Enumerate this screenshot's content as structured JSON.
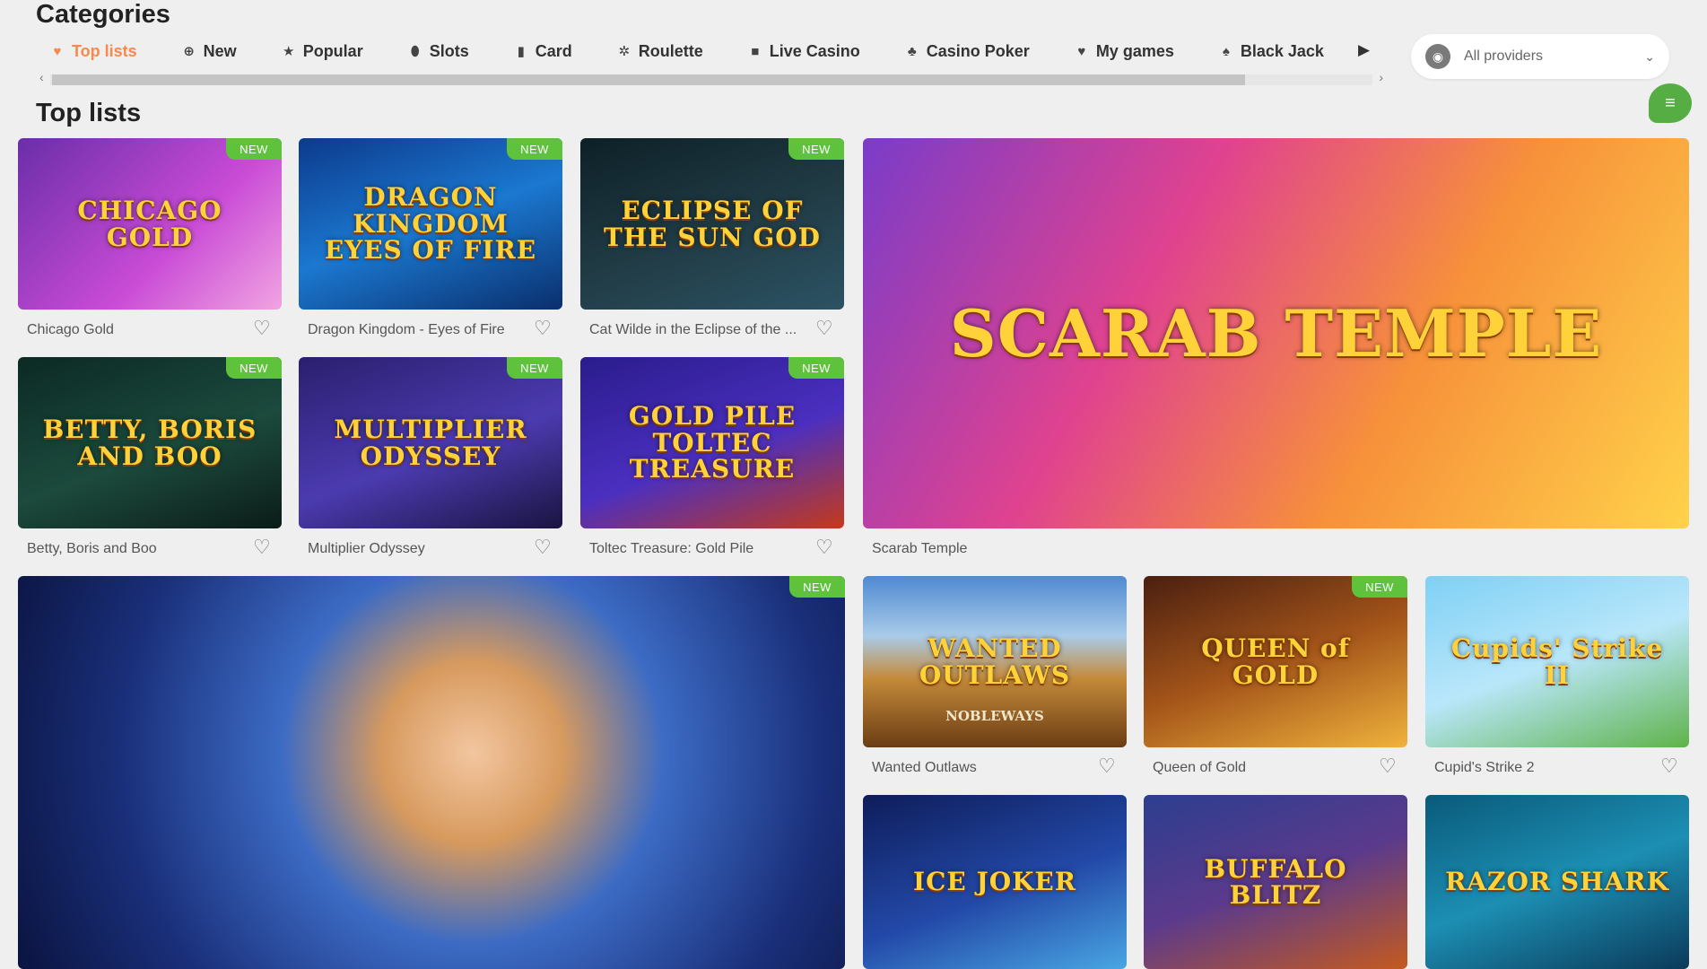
{
  "categories_heading": "Categories",
  "categories": [
    {
      "label": "Top lists",
      "icon": "heart-icon",
      "glyph": "♥",
      "active": true
    },
    {
      "label": "New",
      "icon": "plus-circle-icon",
      "glyph": "⊕",
      "active": false
    },
    {
      "label": "Popular",
      "icon": "star-icon",
      "glyph": "★",
      "active": false
    },
    {
      "label": "Slots",
      "icon": "slots-icon",
      "glyph": "⬮",
      "active": false
    },
    {
      "label": "Card",
      "icon": "card-icon",
      "glyph": "▮",
      "active": false
    },
    {
      "label": "Roulette",
      "icon": "roulette-icon",
      "glyph": "✲",
      "active": false
    },
    {
      "label": "Live Casino",
      "icon": "camera-icon",
      "glyph": "■",
      "active": false
    },
    {
      "label": "Casino Poker",
      "icon": "club-icon",
      "glyph": "♣",
      "active": false
    },
    {
      "label": "My games",
      "icon": "heart-icon",
      "glyph": "♥",
      "active": false
    },
    {
      "label": "Black Jack",
      "icon": "spade-icon",
      "glyph": "♠",
      "active": false
    }
  ],
  "category_next_glyph": "▶",
  "providers": {
    "label": "All providers",
    "icon_glyph": "◉",
    "chevron": "⌄"
  },
  "chat_glyph": "≡",
  "section_heading": "Top lists",
  "badge_text": "NEW",
  "heart_glyph": "♡",
  "games": [
    {
      "name": "Chicago Gold",
      "logo": "CHICAGO GOLD",
      "is_new": true,
      "bg": "linear-gradient(135deg,#6a2ea8,#c94bd6 60%,#f1a4e2)"
    },
    {
      "name": "Dragon Kingdom - Eyes of Fire",
      "logo": "DRAGON KINGDOM EYES OF FIRE",
      "is_new": true,
      "bg": "linear-gradient(160deg,#0c3a8c,#1b78d0 50%,#0a2f6d)"
    },
    {
      "name": "Cat Wilde in the Eclipse of the ...",
      "logo": "ECLIPSE OF THE SUN GOD",
      "is_new": true,
      "bg": "linear-gradient(160deg,#0d2027,#203a43 50%,#2c5364)"
    },
    {
      "name": "Scarab Temple",
      "logo": "SCARAB TEMPLE",
      "is_new": false,
      "bg": "linear-gradient(120deg,#7a3cc9,#e0428f 35%,#f7913a 65%,#ffd24a)"
    },
    {
      "name": "Betty, Boris and Boo",
      "logo": "BETTY, BORIS AND BOO",
      "is_new": true,
      "bg": "linear-gradient(160deg,#0b2a24,#1c4a3d 55%,#0b1c18)"
    },
    {
      "name": "Multiplier Odyssey",
      "logo": "MULTIPLIER ODYSSEY",
      "is_new": true,
      "bg": "linear-gradient(160deg,#2a1f6e,#4b3bb0 55%,#1a1440)"
    },
    {
      "name": "Toltec Treasure: Gold Pile",
      "logo": "GOLD PILE TOLTEC TREASURE",
      "is_new": true,
      "bg": "linear-gradient(160deg,#2a1c8c,#4b2fc0 55%,#c43a1a)"
    },
    {
      "name": "",
      "logo": "",
      "is_new": true,
      "bg": "radial-gradient(circle at 55% 45%,#f3c6a0 0%,#d79a5e 18%,#3c6bc4 38%,#1a2f7a 70%,#0b1440 100%)"
    },
    {
      "name": "Wanted Outlaws",
      "logo": "WANTED OUTLAWS",
      "sub": "NOBLEWAYS",
      "is_new": false,
      "bg": "linear-gradient(180deg,#4e8ad1,#a9cbe8 35%,#c48a3a 60%,#6b3c14)"
    },
    {
      "name": "Queen of Gold",
      "logo": "QUEEN of GOLD",
      "is_new": true,
      "bg": "linear-gradient(160deg,#4a1f10,#a35419 50%,#f0b23c)"
    },
    {
      "name": "Cupid's Strike 2",
      "logo": "Cupids' Strike II",
      "is_new": false,
      "bg": "linear-gradient(160deg,#7fd0f5,#b9e7fa 50%,#5fb34a)"
    },
    {
      "name": "",
      "logo": "ICE JOKER",
      "is_new": false,
      "bg": "linear-gradient(160deg,#0e1d5a,#2349a8 55%,#49a6e3)"
    },
    {
      "name": "",
      "logo": "BUFFALO BLITZ",
      "is_new": false,
      "bg": "linear-gradient(160deg,#2c3e8f,#5b3a8c 50%,#c45a1f)"
    },
    {
      "name": "",
      "logo": "RAZOR SHARK",
      "is_new": false,
      "bg": "linear-gradient(160deg,#0a5a7a,#1c8fb3 50%,#0b3a5a)"
    }
  ]
}
